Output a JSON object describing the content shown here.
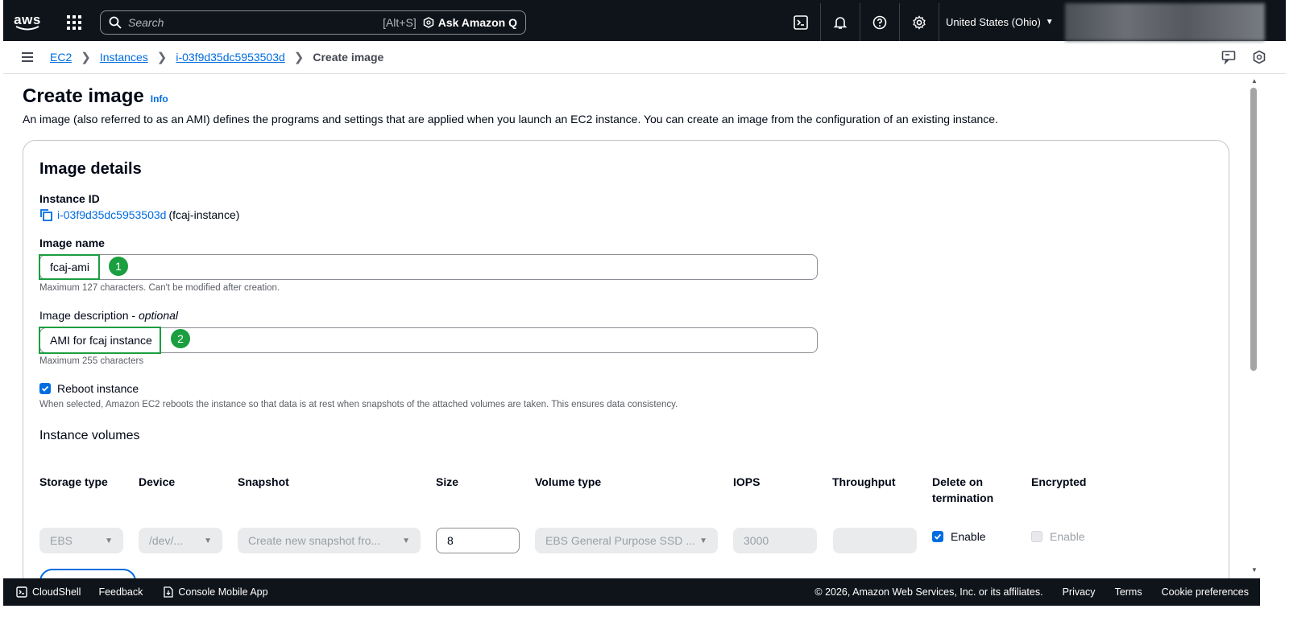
{
  "topnav": {
    "logo_text": "aws",
    "search_placeholder": "Search",
    "search_shortcut": "[Alt+S]",
    "ask_q_label": "Ask Amazon Q",
    "region_label": "United States (Ohio)",
    "icons": [
      "cloudshell-icon",
      "bell-icon",
      "help-icon",
      "gear-icon"
    ]
  },
  "breadcrumb": {
    "items": [
      "EC2",
      "Instances",
      "i-03f9d35dc5953503d"
    ],
    "current": "Create image"
  },
  "page": {
    "title": "Create image",
    "info_label": "Info",
    "description": "An image (also referred to as an AMI) defines the programs and settings that are applied when you launch an EC2 instance. You can create an image from the configuration of an existing instance."
  },
  "image_details": {
    "heading": "Image details",
    "instance_id_label": "Instance ID",
    "instance_id": "i-03f9d35dc5953503d",
    "instance_name": "(fcaj-instance)",
    "image_name_label": "Image name",
    "image_name_value": "fcaj-ami",
    "image_name_hint": "Maximum 127 characters. Can't be modified after creation.",
    "image_desc_label": "Image description",
    "image_desc_optional": "optional",
    "image_desc_value": "AMI for fcaj instance",
    "image_desc_hint": "Maximum 255 characters",
    "reboot_label": "Reboot instance",
    "reboot_checked": true,
    "reboot_hint": "When selected, Amazon EC2 reboots the instance so that data is at rest when snapshots of the attached volumes are taken. This ensures data consistency.",
    "step_badges": [
      "1",
      "2"
    ]
  },
  "volumes": {
    "heading": "Instance volumes",
    "columns": [
      "Storage type",
      "Device",
      "Snapshot",
      "Size",
      "Volume type",
      "IOPS",
      "Throughput",
      "Delete on termination",
      "Encrypted"
    ],
    "row": {
      "storage_type": "EBS",
      "device": "/dev/...",
      "snapshot": "Create new snapshot fro...",
      "size": "8",
      "volume_type": "EBS General Purpose SSD ...",
      "iops": "3000",
      "throughput": "",
      "delete_on_termination": "Enable",
      "encrypted": "Enable"
    }
  },
  "footer": {
    "cloudshell": "CloudShell",
    "feedback": "Feedback",
    "mobile_app": "Console Mobile App",
    "copyright": "© 2026, Amazon Web Services, Inc. or its affiliates.",
    "privacy": "Privacy",
    "terms": "Terms",
    "cookies": "Cookie preferences"
  },
  "colors": {
    "nav_bg": "#0f141a",
    "link": "#006ce0",
    "highlight": "#1a9e3f"
  }
}
